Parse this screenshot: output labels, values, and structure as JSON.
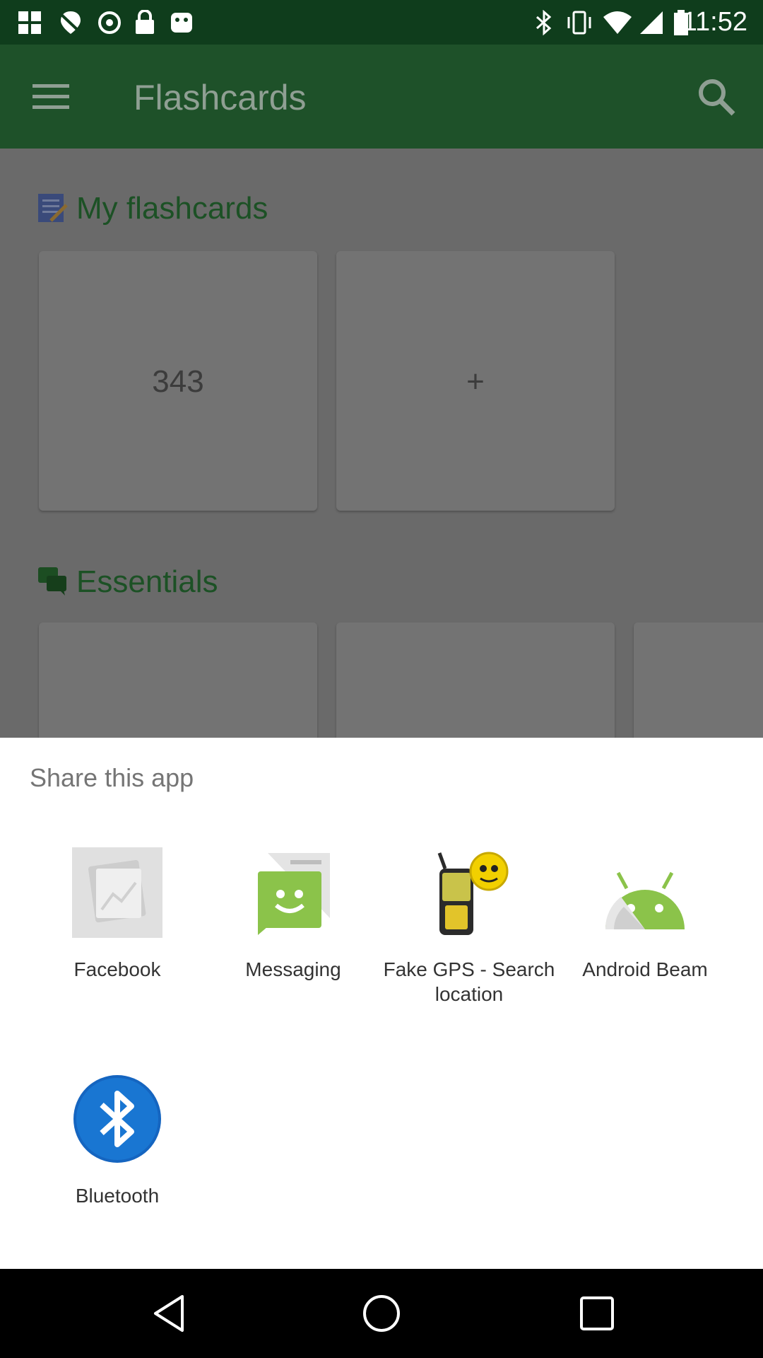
{
  "status_bar": {
    "time": "11:52",
    "icons_left": [
      "fake-gps-icon",
      "location-off-icon",
      "sync-icon",
      "lock-icon",
      "android-icon"
    ],
    "icons_right": [
      "bluetooth-icon",
      "vibrate-icon",
      "wifi-icon",
      "cellular-signal-icon",
      "battery-icon"
    ]
  },
  "app_bar": {
    "title": "Flashcards",
    "menu_icon": "hamburger-menu-icon",
    "search_icon": "search-icon",
    "color": "#1e5129"
  },
  "sections": [
    {
      "title": "My flashcards",
      "icon": "notebook-icon",
      "cards": [
        "343",
        "+"
      ]
    },
    {
      "title": "Essentials",
      "icon": "chat-bubbles-icon",
      "cards": [
        "",
        "",
        ""
      ]
    }
  ],
  "share_sheet": {
    "title": "Share this app",
    "apps": [
      {
        "label": "Facebook",
        "icon": "facebook-placeholder-icon"
      },
      {
        "label": "Messaging",
        "icon": "messaging-icon"
      },
      {
        "label": "Fake GPS - Search location",
        "icon": "fake-gps-icon"
      },
      {
        "label": "Android Beam",
        "icon": "android-beam-icon"
      },
      {
        "label": "Bluetooth",
        "icon": "bluetooth-icon"
      }
    ]
  },
  "nav_bar": {
    "buttons": [
      "back-icon",
      "home-icon",
      "recents-icon"
    ]
  }
}
